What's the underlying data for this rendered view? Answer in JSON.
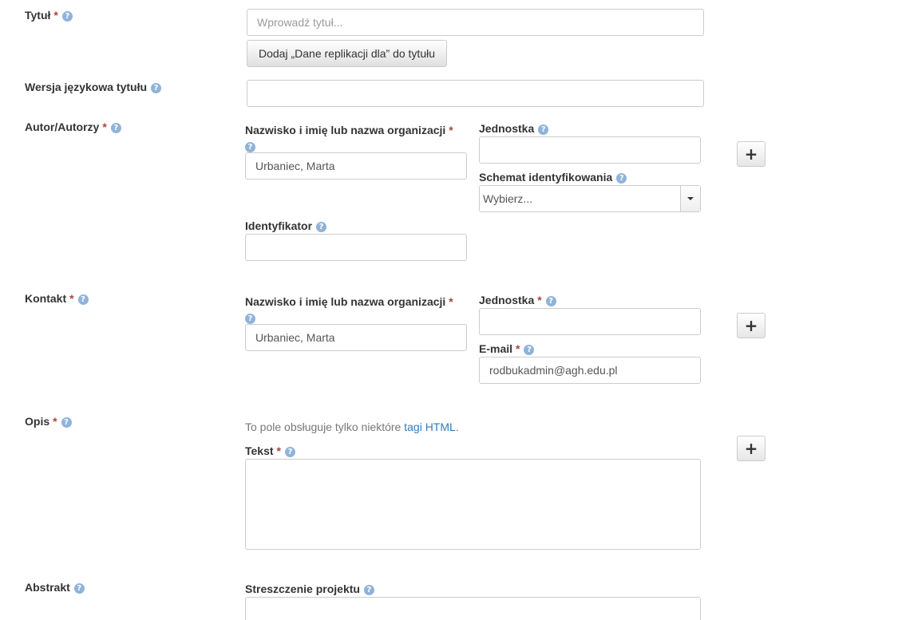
{
  "required_mark": "*",
  "help_glyph": "?",
  "plus_glyph": "+",
  "title": {
    "label": "Tytuł",
    "placeholder": "Wprowadź tytuł...",
    "value": "",
    "replication_button": "Dodaj „Dane replikacji dla” do tytułu"
  },
  "title_translation": {
    "label": "Wersja językowa tytułu",
    "value": ""
  },
  "author": {
    "label": "Autor/Autorzy",
    "name_label": "Nazwisko i imię lub nazwa organizacji",
    "name_value": "Urbaniec, Marta",
    "affiliation_label": "Jednostka",
    "affiliation_value": "",
    "scheme_label": "Schemat identyfikowania",
    "scheme_value": "Wybierz...",
    "identifier_label": "Identyfikator",
    "identifier_value": ""
  },
  "contact": {
    "label": "Kontakt",
    "name_label": "Nazwisko i imię lub nazwa organizacji",
    "name_value": "Urbaniec, Marta",
    "affiliation_label": "Jednostka",
    "affiliation_value": "",
    "email_label": "E-mail",
    "email_value": "rodbukadmin@agh.edu.pl"
  },
  "description": {
    "label": "Opis",
    "hint_prefix": "To pole obsługuje tylko niektóre ",
    "hint_link": "tagi HTML",
    "hint_suffix": ".",
    "text_label": "Tekst",
    "text_value": ""
  },
  "abstract": {
    "label": "Abstrakt",
    "summary_label": "Streszczenie projektu",
    "summary_value": ""
  },
  "colors": {
    "required": "#a94442",
    "help": "#8fb3d9",
    "link": "#337ab7"
  }
}
